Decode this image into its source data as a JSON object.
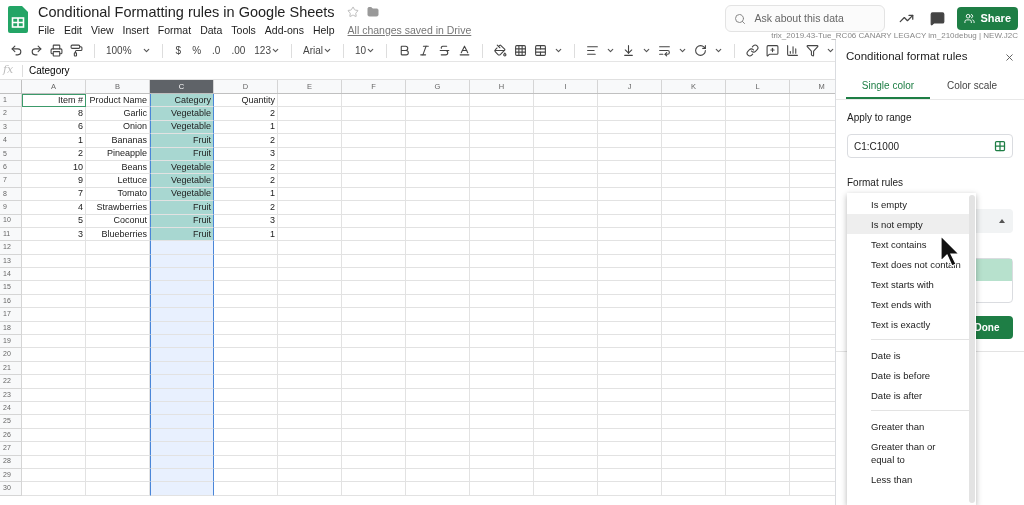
{
  "document": {
    "title": "Conditional Formatting rules in Google Sheets",
    "save_status": "All changes saved in Drive"
  },
  "menu": [
    "File",
    "Edit",
    "View",
    "Insert",
    "Format",
    "Data",
    "Tools",
    "Add-ons",
    "Help"
  ],
  "search": {
    "placeholder": "Ask about this data"
  },
  "share_button": "Share",
  "build_info": "trix_2019.43-Tue_RC06 CANARY LEGACY im_210debug | NEW.J2C",
  "toolbar": {
    "zoom": "100%",
    "currency": "$",
    "percent": "%",
    "decrease_decimals": ".0",
    "increase_decimals": ".00",
    "number_format": "123",
    "font": "Arial",
    "font_size": "10"
  },
  "formula_bar": {
    "label": "fx",
    "value": "Category"
  },
  "sheet": {
    "columns": [
      {
        "label": "A",
        "selected": false,
        "conditional_fill": false
      },
      {
        "label": "B",
        "selected": false,
        "conditional_fill": false
      },
      {
        "label": "C",
        "selected": true,
        "conditional_fill": true
      },
      {
        "label": "D",
        "selected": false,
        "conditional_fill": false
      },
      {
        "label": "E",
        "selected": false,
        "conditional_fill": false
      },
      {
        "label": "F",
        "selected": false,
        "conditional_fill": false
      },
      {
        "label": "G",
        "selected": false,
        "conditional_fill": false
      },
      {
        "label": "H",
        "selected": false,
        "conditional_fill": false
      },
      {
        "label": "I",
        "selected": false,
        "conditional_fill": false
      },
      {
        "label": "J",
        "selected": false,
        "conditional_fill": false
      },
      {
        "label": "K",
        "selected": false,
        "conditional_fill": false
      },
      {
        "label": "L",
        "selected": false,
        "conditional_fill": false
      },
      {
        "label": "M",
        "selected": false,
        "conditional_fill": false
      }
    ],
    "rows": [
      {
        "label": "1",
        "cells": [
          {
            "text": "Item #",
            "active": true
          },
          {
            "text": "Product Name",
            "active": false
          },
          {
            "text": "Category",
            "active": false
          },
          {
            "text": "Quantity",
            "active": false
          }
        ]
      },
      {
        "label": "2",
        "cells": [
          {
            "text": "8",
            "active": false
          },
          {
            "text": "Garlic",
            "active": false
          },
          {
            "text": "Vegetable",
            "active": false
          },
          {
            "text": "2",
            "active": false
          }
        ]
      },
      {
        "label": "3",
        "cells": [
          {
            "text": "6",
            "active": false
          },
          {
            "text": "Onion",
            "active": false
          },
          {
            "text": "Vegetable",
            "active": false
          },
          {
            "text": "1",
            "active": false
          }
        ]
      },
      {
        "label": "4",
        "cells": [
          {
            "text": "1",
            "active": false
          },
          {
            "text": "Bananas",
            "active": false
          },
          {
            "text": "Fruit",
            "active": false
          },
          {
            "text": "2",
            "active": false
          }
        ]
      },
      {
        "label": "5",
        "cells": [
          {
            "text": "2",
            "active": false
          },
          {
            "text": "Pineapple",
            "active": false
          },
          {
            "text": "Fruit",
            "active": false
          },
          {
            "text": "3",
            "active": false
          }
        ]
      },
      {
        "label": "6",
        "cells": [
          {
            "text": "10",
            "active": false
          },
          {
            "text": "Beans",
            "active": false
          },
          {
            "text": "Vegetable",
            "active": false
          },
          {
            "text": "2",
            "active": false
          }
        ]
      },
      {
        "label": "7",
        "cells": [
          {
            "text": "9",
            "active": false
          },
          {
            "text": "Lettuce",
            "active": false
          },
          {
            "text": "Vegetable",
            "active": false
          },
          {
            "text": "2",
            "active": false
          }
        ]
      },
      {
        "label": "8",
        "cells": [
          {
            "text": "7",
            "active": false
          },
          {
            "text": "Tomato",
            "active": false
          },
          {
            "text": "Vegetable",
            "active": false
          },
          {
            "text": "1",
            "active": false
          }
        ]
      },
      {
        "label": "9",
        "cells": [
          {
            "text": "4",
            "active": false
          },
          {
            "text": "Strawberries",
            "active": false
          },
          {
            "text": "Fruit",
            "active": false
          },
          {
            "text": "2",
            "active": false
          }
        ]
      },
      {
        "label": "10",
        "cells": [
          {
            "text": "5",
            "active": false
          },
          {
            "text": "Coconut",
            "active": false
          },
          {
            "text": "Fruit",
            "active": false
          },
          {
            "text": "3",
            "active": false
          }
        ]
      },
      {
        "label": "11",
        "cells": [
          {
            "text": "3",
            "active": false
          },
          {
            "text": "Blueberries",
            "active": false
          },
          {
            "text": "Fruit",
            "active": false
          },
          {
            "text": "1",
            "active": false
          }
        ]
      },
      {
        "label": "12"
      },
      {
        "label": "13"
      },
      {
        "label": "14"
      },
      {
        "label": "15"
      },
      {
        "label": "16"
      },
      {
        "label": "17"
      },
      {
        "label": "18"
      },
      {
        "label": "19"
      },
      {
        "label": "20"
      },
      {
        "label": "21"
      },
      {
        "label": "22"
      },
      {
        "label": "23"
      },
      {
        "label": "24"
      },
      {
        "label": "25"
      },
      {
        "label": "26"
      },
      {
        "label": "27"
      },
      {
        "label": "28"
      },
      {
        "label": "29"
      },
      {
        "label": "30"
      }
    ]
  },
  "panel": {
    "title": "Conditional format rules",
    "tabs": [
      {
        "label": "Single color",
        "selected": true
      },
      {
        "label": "Color scale",
        "selected": false
      }
    ],
    "range_label": "Apply to range",
    "range_value": "C1:C1000",
    "rules_label": "Format rules",
    "done_button": "Done",
    "condition_menu": [
      {
        "kind": "item",
        "label": "Is empty",
        "selected": false
      },
      {
        "kind": "item",
        "label": "Is not empty",
        "selected": true
      },
      {
        "kind": "item",
        "label": "Text contains",
        "selected": false
      },
      {
        "kind": "item",
        "label": "Text does not contain",
        "selected": false
      },
      {
        "kind": "item",
        "label": "Text starts with",
        "selected": false
      },
      {
        "kind": "item",
        "label": "Text ends with",
        "selected": false
      },
      {
        "kind": "item",
        "label": "Text is exactly",
        "selected": false
      },
      {
        "kind": "separator"
      },
      {
        "kind": "item",
        "label": "Date is",
        "selected": false
      },
      {
        "kind": "item",
        "label": "Date is before",
        "selected": false
      },
      {
        "kind": "item",
        "label": "Date is after",
        "selected": false
      },
      {
        "kind": "separator"
      },
      {
        "kind": "item",
        "label": "Greater than",
        "selected": false
      },
      {
        "kind": "item",
        "label": "Greater than or equal to",
        "selected": false
      },
      {
        "kind": "item",
        "label": "Less than",
        "selected": false
      }
    ]
  }
}
